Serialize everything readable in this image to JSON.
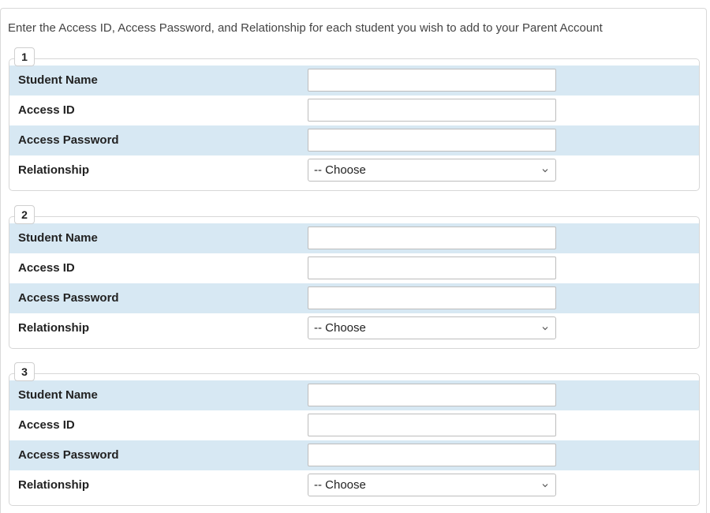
{
  "instructions": "Enter the Access ID, Access Password, and Relationship for each student you wish to add to your Parent Account",
  "students": [
    {
      "number": "1",
      "fields": {
        "student_name": {
          "label": "Student Name",
          "value": ""
        },
        "access_id": {
          "label": "Access ID",
          "value": ""
        },
        "access_password": {
          "label": "Access Password",
          "value": ""
        },
        "relationship": {
          "label": "Relationship",
          "selected": "-- Choose"
        }
      }
    },
    {
      "number": "2",
      "fields": {
        "student_name": {
          "label": "Student Name",
          "value": ""
        },
        "access_id": {
          "label": "Access ID",
          "value": ""
        },
        "access_password": {
          "label": "Access Password",
          "value": ""
        },
        "relationship": {
          "label": "Relationship",
          "selected": "-- Choose"
        }
      }
    },
    {
      "number": "3",
      "fields": {
        "student_name": {
          "label": "Student Name",
          "value": ""
        },
        "access_id": {
          "label": "Access ID",
          "value": ""
        },
        "access_password": {
          "label": "Access Password",
          "value": ""
        },
        "relationship": {
          "label": "Relationship",
          "selected": "-- Choose"
        }
      }
    }
  ],
  "colors": {
    "row_shade": "#d7e8f3",
    "border": "#d7d7d7"
  },
  "icons": {
    "select_arrow": "chevron-down-icon"
  }
}
